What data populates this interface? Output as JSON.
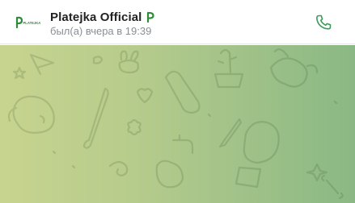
{
  "chat": {
    "title": "Platejka Official",
    "status": "был(а) вчера в 19:39",
    "avatar_text": "PLATEJKA",
    "verified_icon": "brand-badge-icon"
  },
  "header": {
    "call_icon": "phone-icon"
  },
  "colors": {
    "brand_green": "#2e8b3a",
    "accent_call": "#3d9a5a",
    "background_gradient_start": "#c7d48f",
    "background_gradient_end": "#8ab884"
  }
}
